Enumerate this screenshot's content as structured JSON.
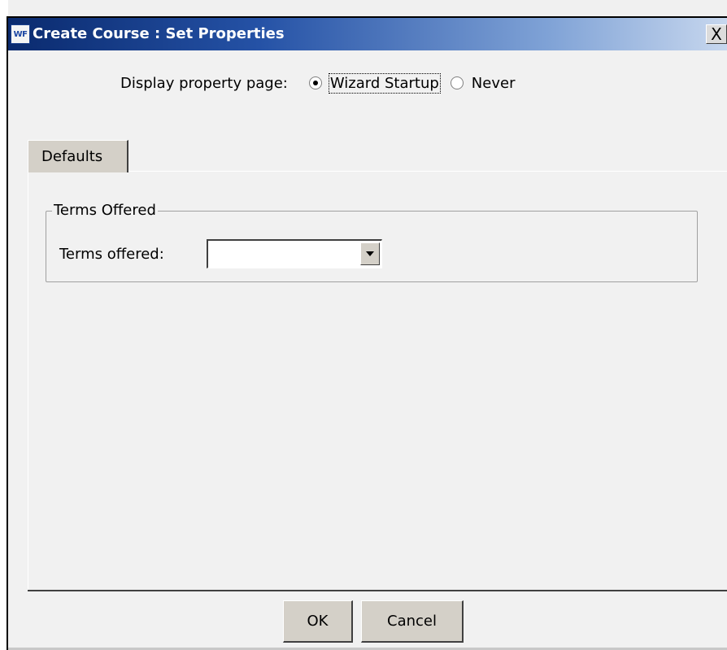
{
  "window": {
    "title": "Create Course : Set Properties",
    "logo_text": "WF",
    "close_glyph": "X"
  },
  "display_property": {
    "label": "Display property page:",
    "options": [
      {
        "label": "Wizard Startup",
        "selected": true
      },
      {
        "label": "Never",
        "selected": false
      }
    ]
  },
  "tabs": [
    {
      "label": "Defaults",
      "active": true
    }
  ],
  "group": {
    "legend": "Terms Offered",
    "field_label": "Terms offered:",
    "select_value": ""
  },
  "buttons": {
    "ok": "OK",
    "cancel": "Cancel"
  },
  "colors": {
    "titlebar_start": "#0a2a6e",
    "titlebar_end": "#c7d7ee",
    "panel_bg": "#f1f1f1",
    "button_face": "#d4d0c8"
  }
}
